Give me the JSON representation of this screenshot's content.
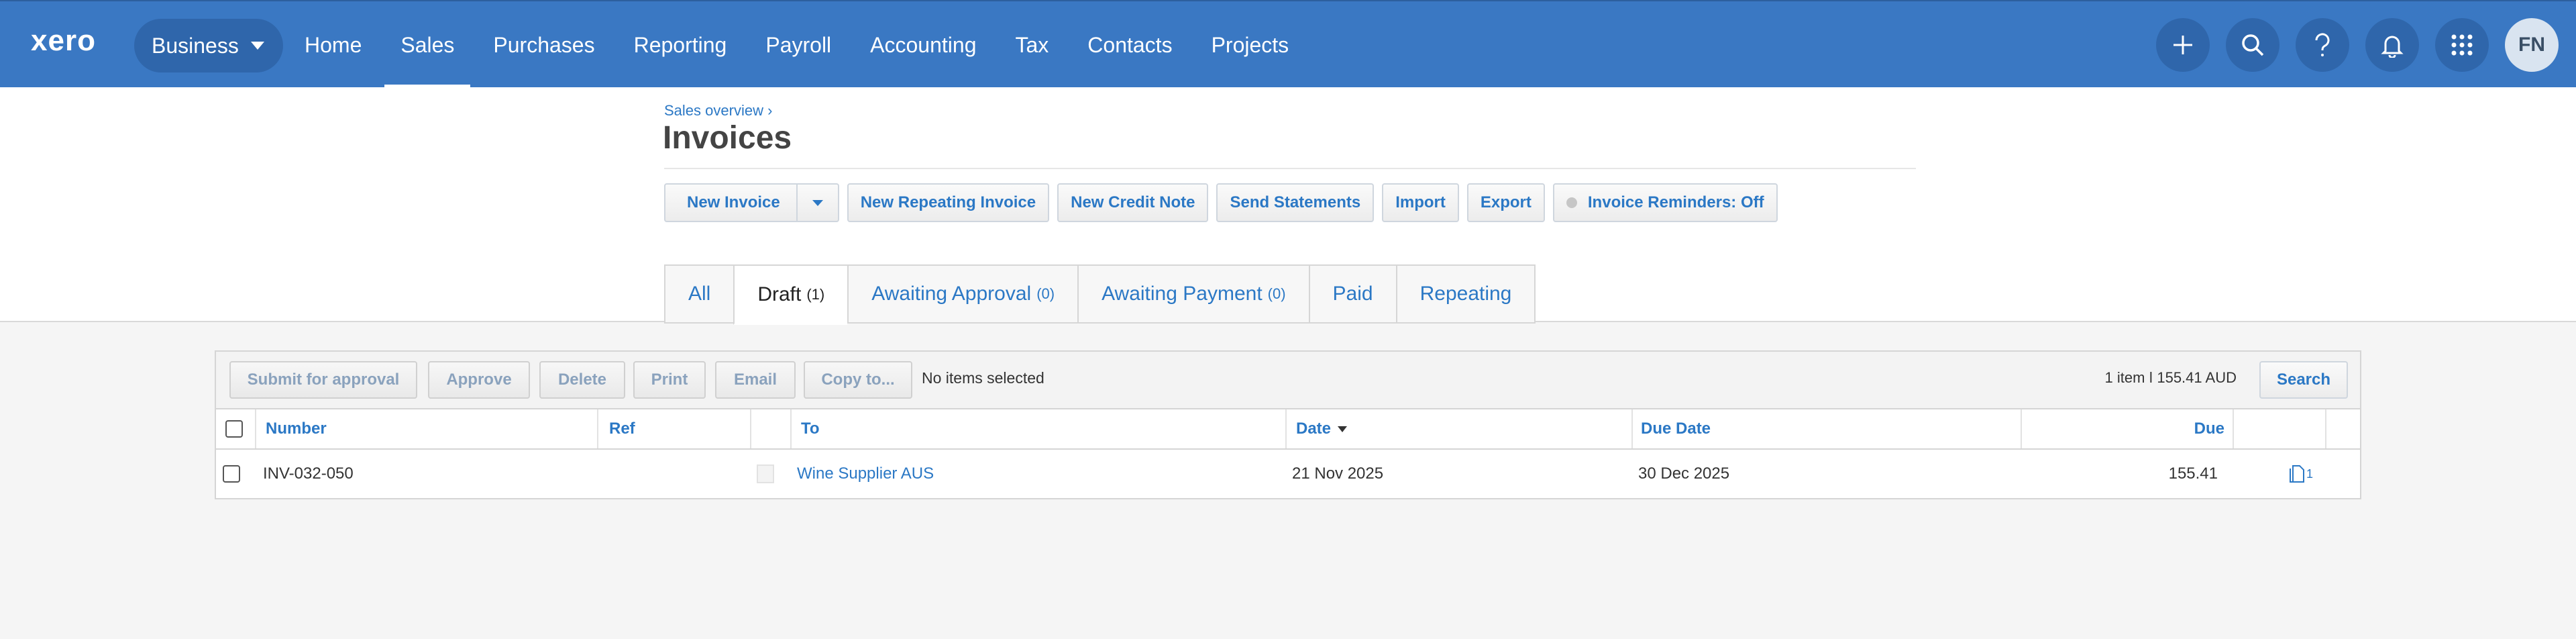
{
  "brand": {
    "logo": "xero"
  },
  "topbar": {
    "org_label": "Business",
    "nav": [
      "Home",
      "Sales",
      "Purchases",
      "Reporting",
      "Payroll",
      "Accounting",
      "Tax",
      "Contacts",
      "Projects"
    ],
    "active_nav": "Sales",
    "avatar_initials": "FN",
    "icons": [
      "plus-icon",
      "search-icon",
      "help-icon",
      "bell-icon",
      "apps-grid-icon"
    ]
  },
  "header": {
    "breadcrumb": "Sales overview ›",
    "title": "Invoices",
    "actions": {
      "new_invoice": "New Invoice",
      "new_repeating_invoice": "New Repeating Invoice",
      "new_credit_note": "New Credit Note",
      "send_statements": "Send Statements",
      "import": "Import",
      "export": "Export",
      "invoice_reminders": "Invoice Reminders: Off"
    }
  },
  "tabs": [
    {
      "label": "All",
      "count": ""
    },
    {
      "label": "Draft",
      "count": "(1)"
    },
    {
      "label": "Awaiting Approval",
      "count": "(0)"
    },
    {
      "label": "Awaiting Payment",
      "count": "(0)"
    },
    {
      "label": "Paid",
      "count": ""
    },
    {
      "label": "Repeating",
      "count": ""
    }
  ],
  "active_tab": "Draft",
  "toolbar": {
    "submit_for_approval": "Submit for approval",
    "approve": "Approve",
    "delete": "Delete",
    "print": "Print",
    "email": "Email",
    "copy_to": "Copy to...",
    "selection_status": "No items selected",
    "summary": "1 item  ǀ 155.41  AUD",
    "search": "Search"
  },
  "table": {
    "columns": {
      "number": "Number",
      "ref": "Ref",
      "to": "To",
      "date": "Date",
      "due_date": "Due Date",
      "due": "Due"
    },
    "rows": [
      {
        "number": "INV-032-050",
        "ref": "",
        "to": "Wine Supplier AUS",
        "date": "21 Nov 2025",
        "due_date": "30 Dec 2025",
        "due": "155.41",
        "files": "1"
      }
    ]
  },
  "colors": {
    "topbar": "#3a78c3",
    "link": "#2b78c5",
    "pill": "#2f66ab"
  }
}
